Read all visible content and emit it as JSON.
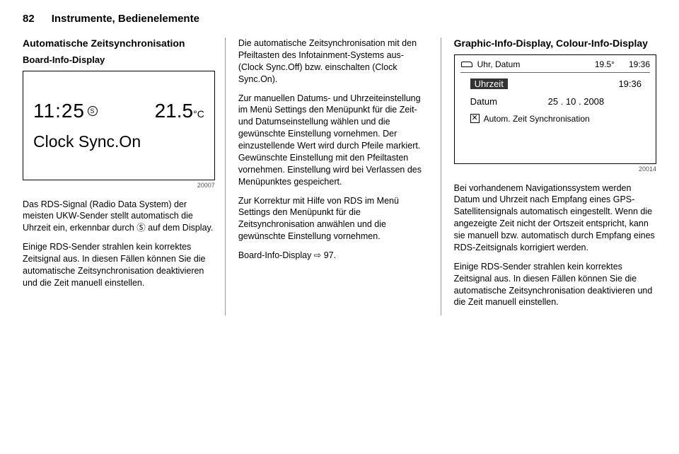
{
  "page_number": "82",
  "chapter_title": "Instrumente, Bedienelemente",
  "col1": {
    "heading": "Automatische Zeitsynchronisation",
    "subheading": "Board-Info-Display",
    "display": {
      "time": "11:25",
      "rds_indicator": "Ⓢ",
      "temperature_value": "21.5",
      "temperature_unit": "°C",
      "main_text": "Clock Sync.On",
      "image_number": "20007"
    },
    "para1": "Das RDS-Signal (Radio Data System) der meisten UKW-Sender stellt automatisch die Uhrzeit ein, erkennbar durch Ⓢ auf dem Display.",
    "para2": "Einige RDS-Sender strahlen kein korrektes Zeitsignal aus. In diesen Fällen können Sie die automatische Zeitsynchronisation deaktivieren und die Zeit manuell einstellen."
  },
  "col2": {
    "para1": "Die automatische Zeitsynchronisation mit den Pfeiltasten des Infotainment-Systems aus- (Clock Sync.Off) bzw. einschalten (Clock Sync.On).",
    "para2": "Zur manuellen Datums- und Uhrzeiteinstellung im Menü Settings den Menüpunkt für die Zeit- und Datumseinstellung wählen und die gewünschte Einstellung vornehmen. Der einzustellende Wert wird durch Pfeile markiert. Gewünschte Einstellung mit den Pfeiltasten vornehmen. Einstellung wird bei Verlassen des Menüpunktes gespeichert.",
    "para3": "Zur Korrektur mit Hilfe von RDS im Menü Settings den Menüpunkt für die Zeitsynchronisation anwählen und die gewünschte Einstellung vornehmen.",
    "para4": "Board-Info-Display ⇨ 97."
  },
  "col3": {
    "heading": "Graphic-Info-Display, Colour-Info-Display",
    "display": {
      "title": "Uhr, Datum",
      "temp": "19.5°",
      "clock": "19:36",
      "row_time_label": "Uhrzeit",
      "row_time_value": "19:36",
      "row_date_label": "Datum",
      "row_date_value": "25 . 10 . 2008",
      "row_sync_label": "Autom. Zeit Synchronisation",
      "image_number": "20014"
    },
    "para1": "Bei vorhandenem Navigationssystem werden Datum und Uhrzeit nach Empfang eines GPS-Satellitensignals automatisch eingestellt. Wenn die angezeigte Zeit nicht der Ortszeit entspricht, kann sie manuell bzw. automatisch durch Empfang eines RDS-Zeitsignals korrigiert werden.",
    "para2": "Einige RDS-Sender strahlen kein korrektes Zeitsignal aus. In diesen Fällen können Sie die automatische Zeitsynchronisation deaktivieren und die Zeit manuell einstellen."
  }
}
